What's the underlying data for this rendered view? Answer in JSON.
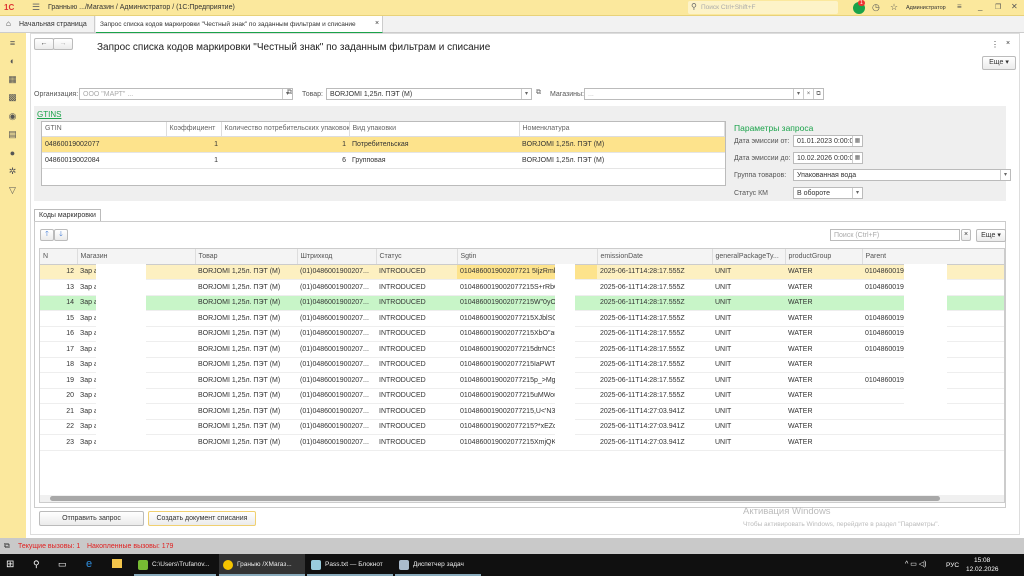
{
  "app": {
    "title": "Гранныю .../Магазин / Администратор /  (1С:Предприятие)",
    "search_placeholder": "Поиск Ctrl+Shift+F",
    "notifications": "1",
    "user": "Администратор"
  },
  "tabs": [
    {
      "label": "Начальная страница"
    },
    {
      "label": "Запрос списка кодов маркировки \"Честный знак\" по заданным фильтрам и списание"
    }
  ],
  "form": {
    "title": "Запрос списка кодов маркировки \"Честный знак\" по заданным фильтрам и списание",
    "more": "Еще"
  },
  "filters": {
    "org_label": "Организация:",
    "org_value": "ООО \"МАРТ\" ...",
    "product_label": "Товар:",
    "product_value": "BORJOMI 1,25л.  ПЭТ (М)",
    "stores_label": "Магазины:",
    "stores_value": "..."
  },
  "gtins": {
    "title": "GTINS",
    "columns": [
      "GTIN",
      "Коэффициент",
      "Количество потребительских упаковок",
      "Вид упаковки",
      "Номенклатура"
    ],
    "rows": [
      [
        "04860019002077",
        "1",
        "1",
        "Потребительская",
        "BORJOMI 1,25л.  ПЭТ (М)"
      ],
      [
        "04860019002084",
        "1",
        "6",
        "Групповая",
        "BORJOMI 1,25л.  ПЭТ (М)"
      ]
    ]
  },
  "params": {
    "title": "Параметры запроса",
    "date_from_label": "Дата эмиссии от:",
    "date_from": "01.01.2023  0:00:0",
    "date_to_label": "Дата эмиссии до:",
    "date_to": "10.02.2026  0:00:0",
    "group_label": "Группа товаров:",
    "group_value": "Упакованная вода",
    "status_label": "Статус КМ",
    "status_value": "В обороте"
  },
  "codes": {
    "tab": "Коды маркировки",
    "search_placeholder": "Поиск (Ctrl+F)",
    "more": "Еще",
    "columns": [
      "N",
      "Магазин",
      "Товар",
      "Штрихкод",
      "Статус",
      "Sgtin",
      "emissionDate",
      "generalPackageTy...",
      "productGroup",
      "Parent"
    ],
    "rows": [
      [
        "12",
        "Зар            а 1а",
        "BORJOMI 1,25л.  ПЭТ (М)",
        "(01)0486001900207...",
        "INTRODUCED",
        "010486001900207721 5IjzRmkV",
        "2025-06-11T14:28:17.555Z",
        "UNIT",
        "WATER",
        "0104860019002084215bf"
      ],
      [
        "13",
        "Зар            а 1а",
        "BORJOMI 1,25л.  ПЭТ (М)",
        "(01)0486001900207...",
        "INTRODUCED",
        "0104860019002077215S+rRbOU",
        "2025-06-11T14:28:17.555Z",
        "UNIT",
        "WATER",
        "0104860019002084215bf"
      ],
      [
        "14",
        "Зар            а 1а",
        "BORJOMI 1,25л.  ПЭТ (М)",
        "(01)0486001900207...",
        "INTRODUCED",
        "0104860019002077215W\"0yOX",
        "2025-06-11T14:28:17.555Z",
        "UNIT",
        "WATER",
        ""
      ],
      [
        "15",
        "Зар            а 1а",
        "BORJOMI 1,25л.  ПЭТ (М)",
        "(01)0486001900207...",
        "INTRODUCED",
        "0104860019002077215XJblSQ*/",
        "2025-06-11T14:28:17.555Z",
        "UNIT",
        "WATER",
        "0104860019002084215bf"
      ],
      [
        "16",
        "Зар            а 1а",
        "BORJOMI 1,25л.  ПЭТ (М)",
        "(01)0486001900207...",
        "INTRODUCED",
        "0104860019002077215XbO\"auu",
        "2025-06-11T14:28:17.555Z",
        "UNIT",
        "WATER",
        "0104860019002084215bf"
      ],
      [
        "17",
        "Зар            а 1а",
        "BORJOMI 1,25л.  ПЭТ (М)",
        "(01)0486001900207...",
        "INTRODUCED",
        "0104860019002077215dtrNCSsU",
        "2025-06-11T14:28:17.555Z",
        "UNIT",
        "WATER",
        "0104860019002084215bf"
      ],
      [
        "18",
        "Зар            а 1а",
        "BORJOMI 1,25л.  ПЭТ (М)",
        "(01)0486001900207...",
        "INTRODUCED",
        "0104860019002077215IaPWTC2",
        "2025-06-11T14:28:17.555Z",
        "UNIT",
        "WATER",
        ""
      ],
      [
        "19",
        "Зар            а 1а",
        "BORJOMI 1,25л.  ПЭТ (М)",
        "(01)0486001900207...",
        "INTRODUCED",
        "0104860019002077215p_>MgZY",
        "2025-06-11T14:28:17.555Z",
        "UNIT",
        "WATER",
        "0104860019002084215bf"
      ],
      [
        "20",
        "Зар            а 1а",
        "BORJOMI 1,25л.  ПЭТ (М)",
        "(01)0486001900207...",
        "INTRODUCED",
        "0104860019002077215uMWoufv,",
        "2025-06-11T14:28:17.555Z",
        "UNIT",
        "WATER",
        ""
      ],
      [
        "21",
        "Зар            а 1а",
        "BORJOMI 1,25л.  ПЭТ (М)",
        "(01)0486001900207...",
        "INTRODUCED",
        "0104860019002077215,U<'N3Mz",
        "2025-06-11T14:27:03.941Z",
        "UNIT",
        "WATER",
        ""
      ],
      [
        "22",
        "Зар            а 1а",
        "BORJOMI 1,25л.  ПЭТ (М)",
        "(01)0486001900207...",
        "INTRODUCED",
        "0104860019002077215?*xEZqO",
        "2025-06-11T14:27:03.941Z",
        "UNIT",
        "WATER",
        ""
      ],
      [
        "23",
        "Зар            а 1а",
        "BORJOMI 1,25л.  ПЭТ (М)",
        "(01)0486001900207...",
        "INTRODUCED",
        "0104860019002077215XmjQKye",
        "2025-06-11T14:27:03.941Z",
        "UNIT",
        "WATER",
        ""
      ]
    ]
  },
  "buttons": {
    "send": "Отправить запрос",
    "create": "Создать документ списания"
  },
  "watermark": {
    "title": "Активация Windows",
    "text": "Чтобы активировать Windows, перейдите в раздел \"Параметры\"."
  },
  "status": {
    "current": "Текущие вызовы: 1",
    "accumulated": "Накопленные вызовы: 179"
  },
  "taskbar": {
    "items": [
      "C:\\Users\\Trufanov...",
      "Граныю /ХМагаз...",
      "Pass.txt — Блокнот",
      "Диспетчер задач"
    ],
    "lang": "РУС",
    "time": "15:08",
    "date": "12.02.2026"
  },
  "colors": {
    "accent": "#fbe89d",
    "green": "#1aa34a",
    "selected": "#fde38c"
  }
}
